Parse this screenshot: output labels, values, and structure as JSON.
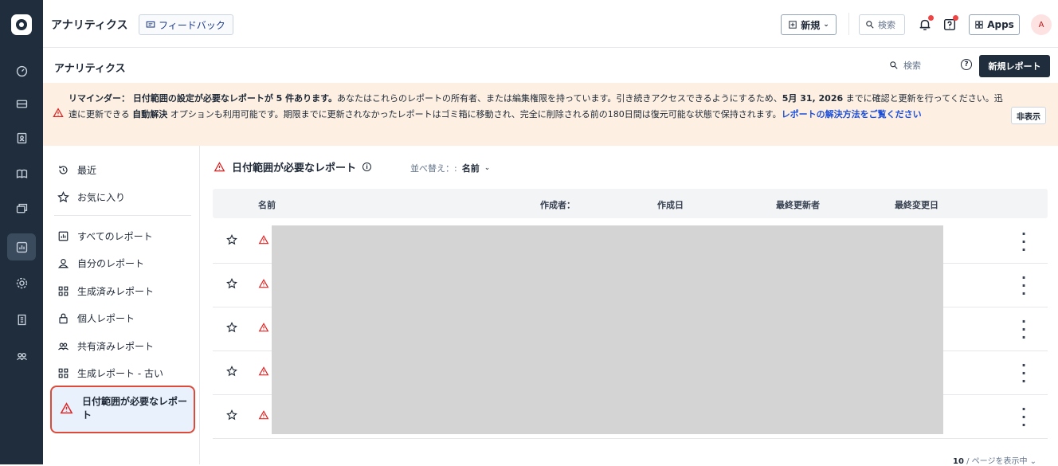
{
  "topbar": {
    "app_title": "アナリティクス",
    "feedback_label": "フィードバック",
    "new_label": "新規",
    "search_placeholder": "検索",
    "apps_label": "Apps",
    "avatar_initial": "A"
  },
  "page": {
    "title": "アナリティクス",
    "search_placeholder": "検索",
    "new_report_label": "新規レポート"
  },
  "banner": {
    "prefix": "リマインダー： 日付範囲の設定が必要なレポートが 5 件あります。",
    "text1": "あなたはこれらのレポートの所有者、または編集権限を持っています。引き続きアクセスできるようにするため、",
    "deadline": "5月 31, 2026",
    "text2": " までに確認と更新を行ってください。迅速に更新できる ",
    "auto_resolve": "自動解決",
    "text3": " オプションも利用可能です。期限までに更新されなかったレポートはゴミ箱に移動され、完全に削除される前の180日間は復元可能な状態で保持されます。",
    "link": "レポートの解決方法をご覧ください",
    "hide_label": "非表示"
  },
  "nav": {
    "items": [
      {
        "label": "最近"
      },
      {
        "label": "お気に入り"
      },
      {
        "label": "すべてのレポート"
      },
      {
        "label": "自分のレポート"
      },
      {
        "label": "生成済みレポート"
      },
      {
        "label": "個人レポート"
      },
      {
        "label": "共有済みレポート"
      },
      {
        "label": "生成レポート - 古い"
      },
      {
        "label": "日付範囲が必要なレポート"
      }
    ]
  },
  "content": {
    "heading": "日付範囲が必要なレポート",
    "sort_label": "並べ替え：:",
    "sort_value": "名前",
    "columns": [
      "名前",
      "作成者：",
      "作成日",
      "最終更新者",
      "最終変更日"
    ],
    "row_count": 5,
    "pager_count": "10",
    "pager_label": " / ページを表示中"
  }
}
